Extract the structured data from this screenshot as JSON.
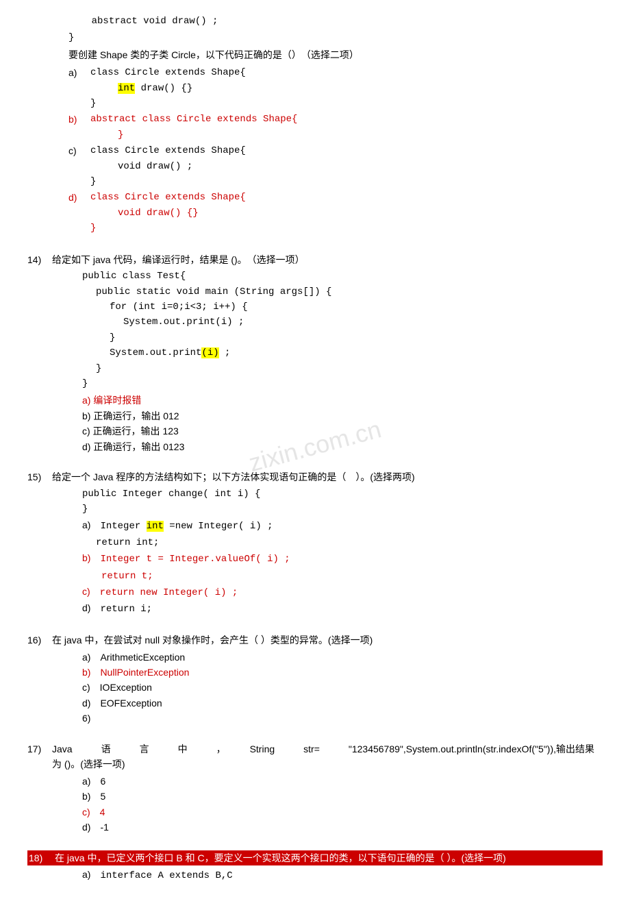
{
  "content": {
    "lines": []
  }
}
